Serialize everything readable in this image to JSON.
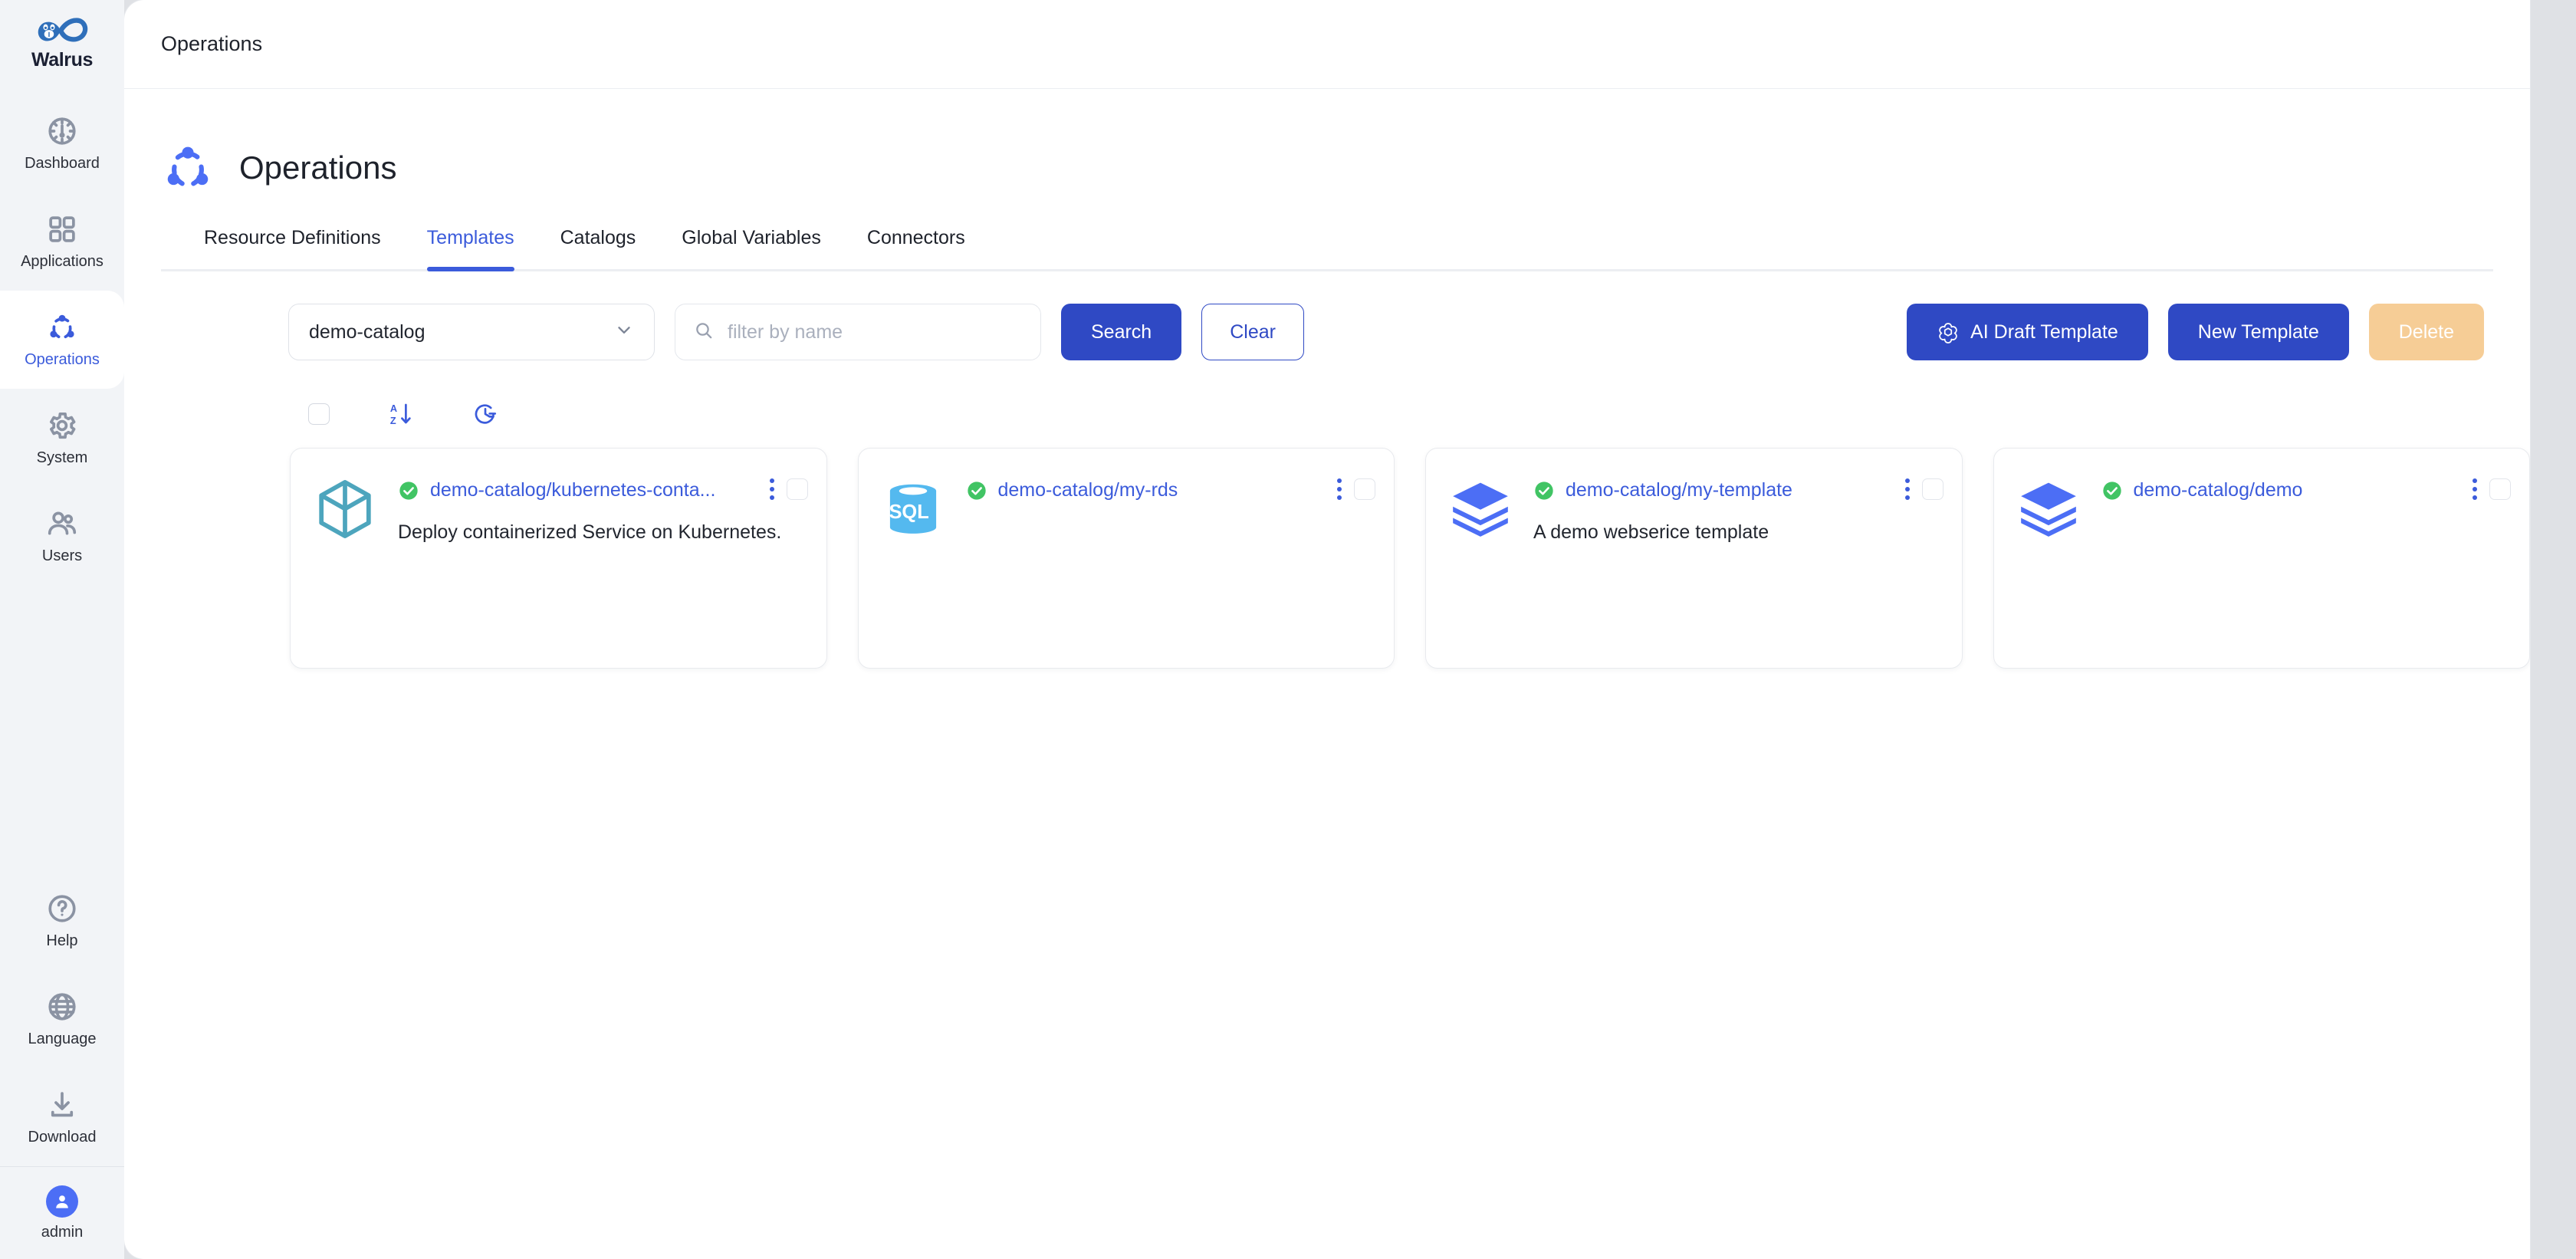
{
  "brand": {
    "name": "Walrus",
    "logo_icon": "walrus-infinity-logo"
  },
  "sidebar": {
    "items": [
      {
        "label": "Dashboard",
        "icon": "dashboard-gauge-icon",
        "active": false
      },
      {
        "label": "Applications",
        "icon": "grid-apps-icon",
        "active": false
      },
      {
        "label": "Operations",
        "icon": "operations-nodes-icon",
        "active": true
      },
      {
        "label": "System",
        "icon": "gear-icon",
        "active": false
      },
      {
        "label": "Users",
        "icon": "users-icon",
        "active": false
      }
    ],
    "bottom_items": [
      {
        "label": "Help",
        "icon": "question-circle-icon"
      },
      {
        "label": "Language",
        "icon": "globe-icon"
      },
      {
        "label": "Download",
        "icon": "download-icon"
      }
    ],
    "user": {
      "label": "admin",
      "icon": "user-avatar-icon"
    }
  },
  "header": {
    "breadcrumb": "Operations"
  },
  "page": {
    "title": "Operations",
    "icon": "operations-nodes-icon"
  },
  "tabs": [
    {
      "label": "Resource Definitions",
      "active": false
    },
    {
      "label": "Templates",
      "active": true
    },
    {
      "label": "Catalogs",
      "active": false
    },
    {
      "label": "Global Variables",
      "active": false
    },
    {
      "label": "Connectors",
      "active": false
    }
  ],
  "filters": {
    "catalog_select": {
      "value": "demo-catalog",
      "icon": "chevron-down-icon"
    },
    "search": {
      "value": "",
      "placeholder": "filter by name",
      "icon": "search-icon"
    },
    "search_button": "Search",
    "clear_button": "Clear"
  },
  "actions": {
    "ai_draft": {
      "label": "AI Draft Template",
      "icon": "openai-spiral-icon"
    },
    "new_template": {
      "label": "New Template"
    },
    "delete": {
      "label": "Delete",
      "disabled": true
    }
  },
  "toolbar": {
    "select_all": {
      "icon": "checkbox-icon",
      "checked": false
    },
    "sort_az": {
      "icon": "sort-az-icon"
    },
    "sort_time": {
      "icon": "clock-history-icon"
    }
  },
  "cards": [
    {
      "icon": "cube-3d-icon",
      "status": "healthy",
      "status_icon": "check-circle-icon",
      "title": "demo-catalog/kubernetes-conta...",
      "description": "Deploy containerized Service on Kubernetes.",
      "menu_icon": "more-vertical-icon",
      "checkbox_icon": "checkbox-icon"
    },
    {
      "icon": "sql-database-icon",
      "status": "healthy",
      "status_icon": "check-circle-icon",
      "title": "demo-catalog/my-rds",
      "description": "",
      "menu_icon": "more-vertical-icon",
      "checkbox_icon": "checkbox-icon"
    },
    {
      "icon": "layers-stack-icon",
      "status": "healthy",
      "status_icon": "check-circle-icon",
      "title": "demo-catalog/my-template",
      "description": "A demo webserice template",
      "menu_icon": "more-vertical-icon",
      "checkbox_icon": "checkbox-icon"
    },
    {
      "icon": "layers-stack-icon",
      "status": "healthy",
      "status_icon": "check-circle-icon",
      "title": "demo-catalog/demo",
      "description": "",
      "menu_icon": "more-vertical-icon",
      "checkbox_icon": "checkbox-icon"
    }
  ],
  "colors": {
    "accent": "#3b5bdb",
    "primary_button": "#2f49c4",
    "disabled_button": "#f6cd96",
    "status_green": "#41c464",
    "sidebar_bg": "#f2f4f7",
    "cube_teal": "#4da5bd",
    "sql_blue": "#54b9ef",
    "layers_blue": "#4c6ef5"
  }
}
